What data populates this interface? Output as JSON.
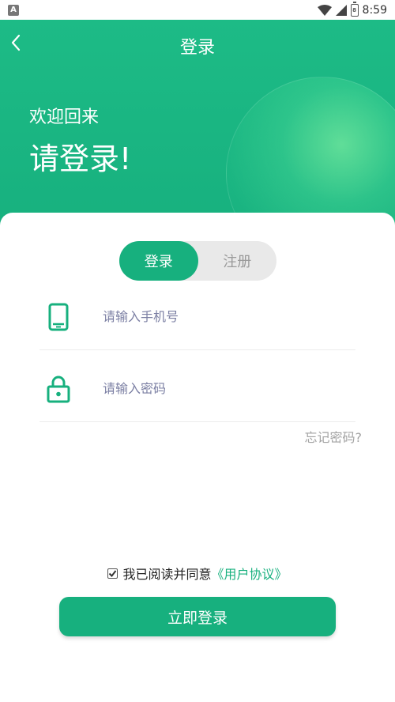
{
  "status_bar": {
    "time": "8:59",
    "battery_level": "8"
  },
  "header": {
    "title": "登录",
    "greeting": "欢迎回来",
    "headline": "请登录!"
  },
  "auth_tabs": [
    {
      "label": "登录",
      "active": true
    },
    {
      "label": "注册",
      "active": false
    }
  ],
  "form": {
    "phone": {
      "value": "",
      "placeholder": "请输入手机号",
      "icon": "phone-icon"
    },
    "password": {
      "value": "",
      "placeholder": "请输入密码",
      "icon": "lock-icon"
    },
    "forgot_label": "忘记密码?"
  },
  "agreement": {
    "checked": true,
    "text": "我已阅读并同意",
    "link": "《用户协议》"
  },
  "submit_label": "立即登录",
  "colors": {
    "accent": "#17b07e",
    "placeholder": "#7b7fa3",
    "muted": "#a3a3a3"
  }
}
